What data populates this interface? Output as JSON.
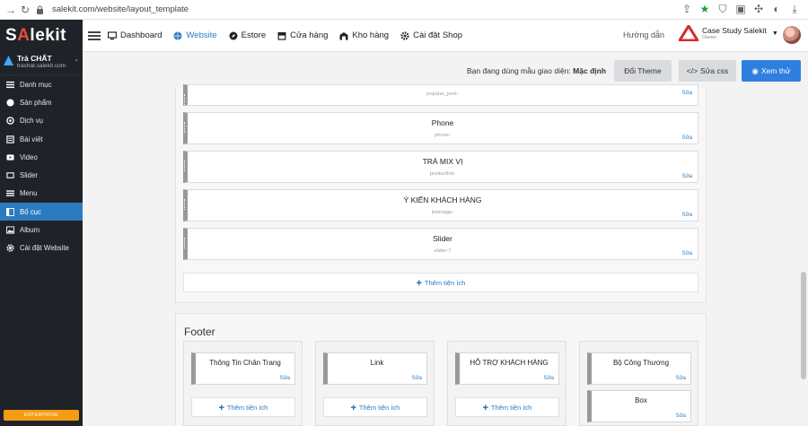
{
  "browser": {
    "url": "salekit.com/website/layout_template"
  },
  "sidebar": {
    "logo_prefix": "S",
    "logo_accent": "A",
    "logo_suffix": "lekit",
    "shop_name": "Trà CHẤT",
    "shop_domain": "trachat.salekit.com",
    "items": [
      {
        "label": "Danh mục",
        "icon": "list-icon"
      },
      {
        "label": "Sản phẩm",
        "icon": "box-icon"
      },
      {
        "label": "Dịch vụ",
        "icon": "service-icon"
      },
      {
        "label": "Bài viết",
        "icon": "article-icon"
      },
      {
        "label": "Video",
        "icon": "video-icon"
      },
      {
        "label": "Slider",
        "icon": "slider-icon"
      },
      {
        "label": "Menu",
        "icon": "menu-icon"
      },
      {
        "label": "Bố cục",
        "icon": "layout-icon",
        "active": true
      },
      {
        "label": "Album",
        "icon": "image-icon"
      },
      {
        "label": "Cài đặt Website",
        "icon": "gear-icon"
      }
    ],
    "enterprise_label": "ENTERPRISE"
  },
  "topnav": {
    "items": [
      {
        "label": "Dashboard",
        "icon": "monitor-icon"
      },
      {
        "label": "Website",
        "icon": "globe-icon",
        "active": true
      },
      {
        "label": "Estore",
        "icon": "compass-icon"
      },
      {
        "label": "Cửa hàng",
        "icon": "store-icon"
      },
      {
        "label": "Kho hàng",
        "icon": "warehouse-icon"
      },
      {
        "label": "Cài đặt Shop",
        "icon": "gear-icon"
      }
    ],
    "help_label": "Hướng dẫn",
    "account_name": "Case Study Salekit",
    "account_role": "Owner"
  },
  "actionbar": {
    "using_text": "Bạn đang dùng mẫu giao diện:",
    "theme_name": "Mặc định",
    "change_theme": "Đổi Theme",
    "edit_css": "Sửa css",
    "preview": "Xem thử"
  },
  "main": {
    "widgets": [
      {
        "title": "",
        "sub": "popular_post-",
        "edit": "Sửa"
      },
      {
        "title": "Phone",
        "sub": "phone-",
        "edit": "Sửa"
      },
      {
        "title": "TRÀ MIX VỊ",
        "sub": "productlist-",
        "edit": "Sửa"
      },
      {
        "title": "Ý KIẾN KHÁCH HÀNG",
        "sub": "listimage-",
        "edit": "Sửa"
      },
      {
        "title": "Slider",
        "sub": "slider-7",
        "edit": "Sửa"
      }
    ],
    "add_label": "Thêm tiện ích"
  },
  "footer": {
    "title": "Footer",
    "columns": [
      {
        "widgets": [
          {
            "title": "Thông Tin Chân Trang",
            "edit": "Sửa"
          }
        ],
        "add": "Thêm tiện ích"
      },
      {
        "widgets": [
          {
            "title": "Link",
            "edit": "Sửa"
          }
        ],
        "add": "Thêm tiện ích"
      },
      {
        "widgets": [
          {
            "title": "HỖ TRỢ KHÁCH HÀNG",
            "edit": "Sửa"
          }
        ],
        "add": "Thêm tiện ích"
      },
      {
        "widgets": [
          {
            "title": "Bộ Công Thương",
            "edit": "Sửa"
          },
          {
            "title": "Box",
            "edit": "Sửa"
          }
        ]
      }
    ]
  },
  "colors": {
    "sidebar_bg": "#1f2329",
    "active_blue": "#2b7bc0",
    "preview_btn": "#2d7fe0",
    "enterprise": "#f39c12",
    "logo_accent": "#e94c3d"
  }
}
